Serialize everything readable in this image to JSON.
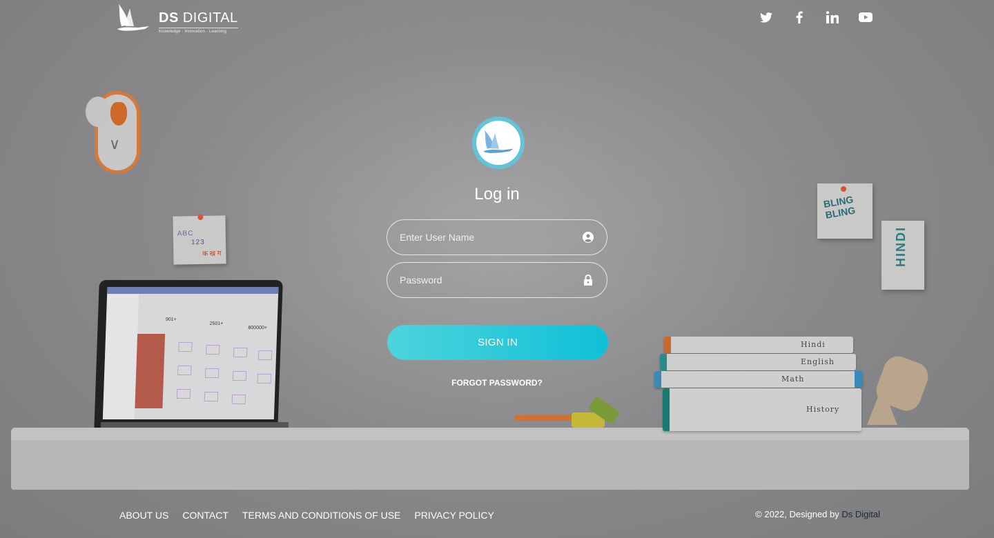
{
  "header": {
    "logo_title_bold": "DS",
    "logo_title_rest": "DIGITAL",
    "logo_tagline": "Knowledge · Innovation · Learning",
    "social": [
      {
        "name": "twitter-icon"
      },
      {
        "name": "facebook-icon"
      },
      {
        "name": "linkedin-icon"
      },
      {
        "name": "youtube-icon"
      }
    ]
  },
  "decor": {
    "note1_line1": "ABC",
    "note1_line2": "123",
    "note1_line3": "क ख ग",
    "note2_text": "BLING BLING",
    "note3_text": "HINDI",
    "books": [
      "Hindi",
      "English",
      "Math",
      "History"
    ],
    "laptop_stats": [
      "901+",
      "2501+",
      "800000+"
    ]
  },
  "login": {
    "title": "Log in",
    "username_placeholder": "Enter User Name",
    "password_placeholder": "Password",
    "signin_label": "SIGN IN",
    "forgot_label": "FORGOT PASSWORD?"
  },
  "footer": {
    "links": [
      "ABOUT US",
      "CONTACT",
      "TERMS AND CONDITIONS OF USE",
      "PRIVACY POLICY"
    ],
    "copyright_prefix": "© 2022, Designed by ",
    "copyright_brand": "Ds Digital"
  },
  "colors": {
    "accent_start": "#4dd4dc",
    "accent_end": "#0fc0d8",
    "avatar_ring": "#62c4d8"
  }
}
